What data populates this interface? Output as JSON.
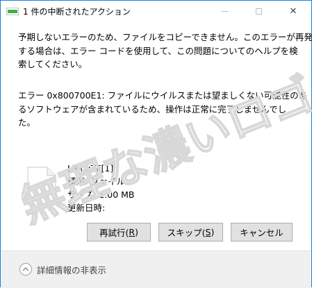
{
  "window": {
    "title": "1 件の中断されたアクション",
    "minimize_label": "",
    "close_symbol": "✕"
  },
  "message": {
    "line1": "予期しないエラーのため、ファイルをコピーできません。このエラーが再発",
    "line2": "する場合は、エラー コードを使用して、この問題についてのヘルプを検",
    "line3": "索してください。",
    "error_line1": "エラー 0x800700E1: ファイルにウイルスまたは望ましくない可能性のあ",
    "error_line2": "るソフトウェアが含まれているため、操作は正常に完了しませんでし",
    "error_line3": "た。"
  },
  "file": {
    "name": "LinuxTF[1]",
    "type": "種類: ファイル",
    "size": "サイズ: 1.00 MB",
    "modified": "更新日時:"
  },
  "buttons": {
    "retry_text": "再試行(",
    "retry_key": "R",
    "retry_end": ")",
    "skip_text": "スキップ(",
    "skip_key": "S",
    "skip_end": ")",
    "cancel": "キャンセル"
  },
  "footer": {
    "details_toggle": "詳細情報の非表示"
  },
  "watermark": {
    "text": "無理な濃いロゴ"
  },
  "colors": {
    "border_accent": "#1883d7",
    "button_face": "#e1e1e1",
    "footer_bg": "#f0f0f0"
  }
}
